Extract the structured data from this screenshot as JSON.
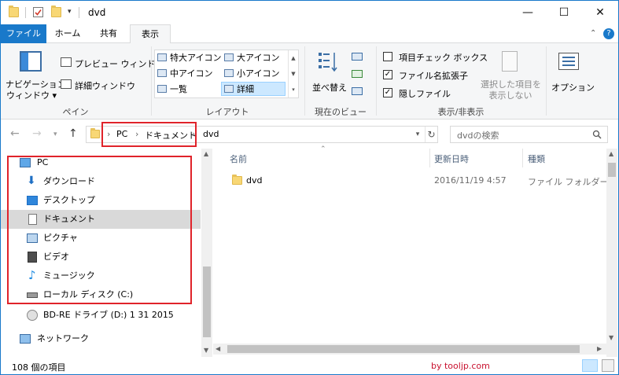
{
  "window": {
    "title": "dvd",
    "minimize_glyph": "—",
    "maximize_glyph": "☐",
    "close_glyph": "✕"
  },
  "tabs": {
    "file": "ファイル",
    "home": "ホーム",
    "share": "共有",
    "view": "表示"
  },
  "ribbon": {
    "navigation_pane": "ナビゲーション\nウィンドウ",
    "navigation_pane_l1": "ナビゲーション",
    "navigation_pane_l2": "ウィンドウ ▾",
    "preview_pane": "プレビュー ウィンドウ",
    "details_pane": "詳細ウィンドウ",
    "group_pane": "ペイン",
    "layout_items": [
      "特大アイコン",
      "大アイコン",
      "中アイコン",
      "小アイコン",
      "一覧",
      "詳細"
    ],
    "layout_selected": "詳細",
    "group_layout": "レイアウト",
    "sort_by": "並べ替え",
    "group_current_view": "現在のビュー",
    "item_check_boxes": "項目チェック ボックス",
    "file_name_extensions": "ファイル名拡張子",
    "hidden_items": "隠しファイル",
    "hide_selected_l1": "選択した項目を",
    "hide_selected_l2": "表示しない",
    "group_show_hide": "表示/非表示",
    "options": "オプション",
    "item_check_boxes_checked": false,
    "file_name_extensions_checked": true,
    "hidden_items_checked": true
  },
  "address": {
    "crumbs": [
      "PC",
      "ドキュメント",
      "dvd"
    ],
    "search_placeholder": "dvdの検索"
  },
  "nav_pane": {
    "items": [
      {
        "label": "PC",
        "icon": "pc-icon"
      },
      {
        "label": "ダウンロード",
        "icon": "download-icon"
      },
      {
        "label": "デスクトップ",
        "icon": "desktop-icon"
      },
      {
        "label": "ドキュメント",
        "icon": "documents-icon"
      },
      {
        "label": "ピクチャ",
        "icon": "pictures-icon"
      },
      {
        "label": "ビデオ",
        "icon": "videos-icon"
      },
      {
        "label": "ミュージック",
        "icon": "music-icon"
      },
      {
        "label": "ローカル ディスク (C:)",
        "icon": "drive-icon"
      },
      {
        "label": "BD-RE ドライブ (D:) 1 31 2015",
        "icon": "disc-icon"
      },
      {
        "label": "ネットワーク",
        "icon": "network-icon"
      }
    ],
    "selected": "ドキュメント"
  },
  "file_list": {
    "columns": [
      "名前",
      "更新日時",
      "種類"
    ],
    "rows": [
      {
        "name": "dvd",
        "modified": "2016/11/19 4:57",
        "type": "ファイル フォルダー"
      }
    ]
  },
  "status": {
    "item_count": "108 個の項目",
    "watermark": "by tooljp.com"
  },
  "colors": {
    "accent": "#1979ca",
    "highlight_red": "#e0232a",
    "selection": "#d9d9d9"
  }
}
